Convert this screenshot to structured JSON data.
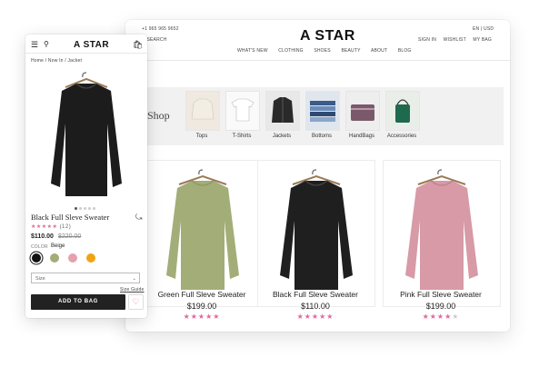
{
  "desktop": {
    "phone": "+1 965 965 9652",
    "search_label": "SEARCH",
    "lang": "EN",
    "currency": "USD",
    "logo": "A STAR",
    "nav": [
      "WHAT'S NEW",
      "CLOTHING",
      "SHOES",
      "BEAUTY",
      "ABOUT",
      "BLOG"
    ],
    "account": [
      "SIGN IN",
      "WISHLIST",
      "MY BAG"
    ],
    "shop_title": "Shop",
    "categories": [
      "Tops",
      "T-Shirts",
      "Jackets",
      "Bottoms",
      "HandBags",
      "Accessories"
    ],
    "products": [
      {
        "name": "Green Full Sleve Sweater",
        "price": "$199.00",
        "rating": 5,
        "color": "#a3ad78"
      },
      {
        "name": "Black Full Sleve Sweater",
        "price": "$110.00",
        "rating": 5,
        "color": "#1f1f1f"
      },
      {
        "name": "Pink Full Sleve Sweater",
        "price": "$199.00",
        "rating": 4,
        "color": "#d79aa6"
      }
    ]
  },
  "mobile": {
    "logo": "A STAR",
    "breadcrumb": "Home / Now In / Jacket",
    "product_name": "Black Full Sleve Sweater",
    "review_count": "(12)",
    "price": "$110.00",
    "old_price": "$220.00",
    "color_label": "COLOR",
    "color_value": "Beige",
    "swatches": [
      "#111111",
      "#a3ad78",
      "#e3a2ad",
      "#f2a313"
    ],
    "size_placeholder": "Size",
    "size_guide": "Size Guide",
    "add_to_bag": "ADD TO BAG",
    "rating": 5,
    "accent": "#e0689a"
  }
}
